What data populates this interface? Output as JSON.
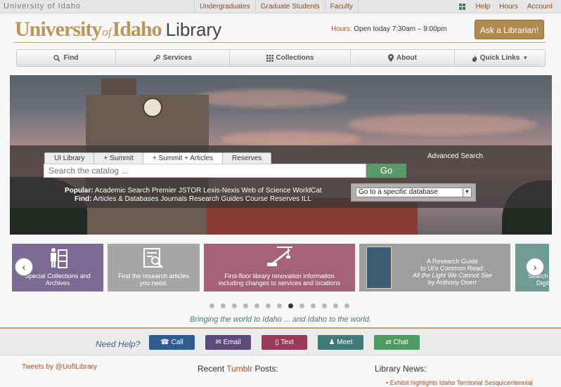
{
  "topbar": {
    "university": "University of Idaho",
    "links": [
      "Undergraduates",
      "Graduate Students",
      "Faculty"
    ],
    "right_links": [
      "Help",
      "Hours",
      "Account"
    ]
  },
  "header": {
    "logo_university": "University",
    "logo_of": "of",
    "logo_idaho": "Idaho",
    "logo_library": "Library",
    "hours_label": "Hours:",
    "hours_text": "Open today 7:30am – 9:00pm",
    "ask_button": "Ask a Librarian!"
  },
  "nav": [
    {
      "icon": "search-icon",
      "label": "Find"
    },
    {
      "icon": "wrench-icon",
      "label": "Services"
    },
    {
      "icon": "grid-icon",
      "label": "Collections"
    },
    {
      "icon": "location-icon",
      "label": "About"
    },
    {
      "icon": "fire-icon",
      "label": "Quick Links"
    }
  ],
  "search": {
    "tabs": [
      "UI Library",
      "+ Summit",
      "+ Summit + Articles",
      "Reserves"
    ],
    "active_tab": 2,
    "advanced": "Advanced Search",
    "placeholder": "Search the catalog ...",
    "go": "Go",
    "popular_label": "Popular:",
    "popular_text": "Academic Search Premier JSTOR Lexis-Nexis Web of Science WorldCat",
    "find_label": "Find:",
    "find_text": "Articles & Databases Journals Research Guides Course Reserves ILL",
    "database_select": "Go to a specific database"
  },
  "carousel": {
    "cards": [
      {
        "line1": "Special Collections and",
        "line2": "Archives",
        "color": "#7b6a93"
      },
      {
        "line1": "Find the research articles",
        "line2": "you need.",
        "color": "#a6a6a6"
      },
      {
        "line1": "First-floor library renovation information",
        "line2": "including changes to services and locations",
        "color": "#a3627a"
      },
      {
        "line1": "A Research Guide",
        "line2": "to UI's Common Read:",
        "line3": "All the Light We Cannot See",
        "line4": "by Anthony Doerr",
        "color": "#9e9e9e"
      },
      {
        "line1": "Search",
        "line2": "Digita",
        "color": "#6f9c93"
      }
    ],
    "prev": "‹",
    "next": "›",
    "dot_count": 13,
    "active_dot": 7
  },
  "tagline": "Bringing the world to Idaho ... and Idaho to the world.",
  "help": {
    "label": "Need Help?",
    "buttons": [
      {
        "icon": "phone-icon",
        "label": "Call",
        "color": "#2f5d8f"
      },
      {
        "icon": "email-icon",
        "label": "Email",
        "color": "#5c4a7a"
      },
      {
        "icon": "mobile-icon",
        "label": "Text",
        "color": "#9a3b5a"
      },
      {
        "icon": "person-icon",
        "label": "Meet",
        "color": "#3f7a76"
      },
      {
        "icon": "chat-icon",
        "label": "Chat",
        "color": "#4f9a63"
      }
    ]
  },
  "footer": {
    "tweets": "Tweets by @UofILibrary",
    "tumblr_prefix": "Recent",
    "tumblr_word": "Tumblr",
    "tumblr_suffix": "Posts:",
    "news_title": "Library News:",
    "news_item": "Exhibit highlights Idaho Territorial Sesquicentennial"
  }
}
